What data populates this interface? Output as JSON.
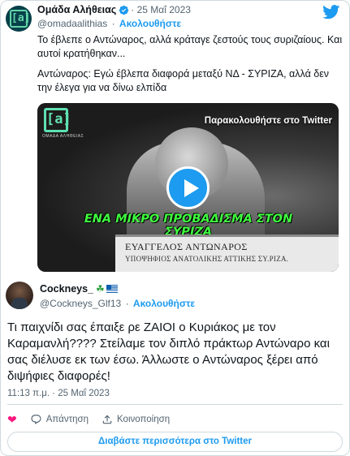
{
  "parent_tweet": {
    "display_name": "Ομάδα Αλήθειας",
    "date": "· 25 Μαΐ 2023",
    "handle": "@omadaalithias",
    "follow_label": "Ακολουθήστε",
    "avatar_mark": "[a]",
    "text_line1": "Το έβλεπε ο Αντώναρος, αλλά κράταγε ζεστούς τους συριζαίους. Και αυτοί κρατήθηκαν...",
    "text_line2": "Αντώναρος: Εγώ έβλεπα διαφορά μεταξύ ΝΔ - ΣΥΡΙΖΑ, αλλά δεν την έλεγα για να δίνω ελπίδα",
    "video": {
      "logo_mark": "[a]",
      "logo_sub": "ΟΜΑΔΑ ΑΛΗΘΕΙΑΣ",
      "watch_label": "Παρακολουθήστε στο Twitter",
      "banner": "ΕΝΑ ΜΙΚΡΟ ΠΡΟΒΑΔΙΣΜΑ ΣΤΟΝ ΣΥΡΙΖΑ",
      "lower_third_name": "ΕΥΑΓΓΕΛΟΣ ΑΝΤΩΝΑΡΟΣ",
      "lower_third_role": "ΥΠΟΨΗΦΙΟΣ ΑΝΑΤΟΛΙΚΗΣ ΑΤΤΙΚΗΣ ΣΥ.ΡΙΖΑ."
    }
  },
  "main_tweet": {
    "display_name": "Cockneys_",
    "handle": "@Cockneys_Glf13",
    "follow_label": "Ακολουθήστε",
    "text": "Τι παιχνίδι σας έπαιξε ρε ΖΑΙΟΙ ο Κυριάκος με τον Καραμανλή???? Στείλαμε τον διπλό πράκτωρ Αντώναρο και σας διέλυσε εκ των έσω. Άλλωστε ο Αντώναρος ξέρει από διψήφιες διαφορές!",
    "timestamp": "11:13 π.μ. · 25 Μαΐ 2023"
  },
  "actions": {
    "reply_label": "Απάντηση",
    "copy_link_label": "Κοινοποίηση"
  },
  "read_more_label": "Διαβάστε περισσότερα στο Twitter",
  "colors": {
    "accent": "#1d9bf0",
    "like": "#f91880",
    "secondary_text": "#536471",
    "border": "#cfd9de"
  }
}
